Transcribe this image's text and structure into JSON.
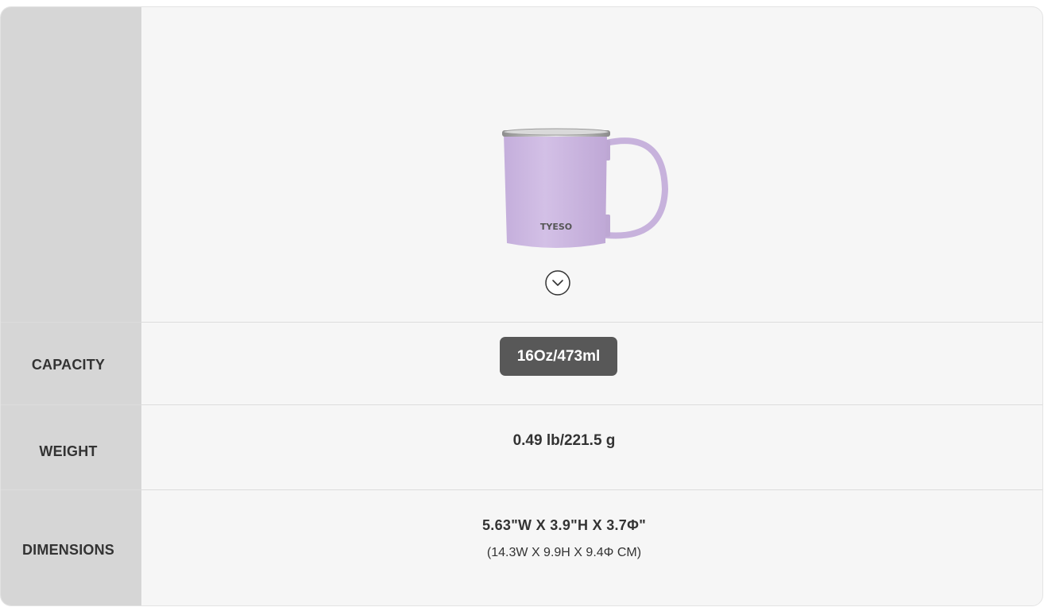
{
  "product": {
    "image_icon": "mug-image",
    "mug_brand": "TYESO",
    "expand_icon": "chevron-down-circle-icon"
  },
  "specs": {
    "capacity": {
      "label": "CAPACITY",
      "value": "16Oz/473ml"
    },
    "weight": {
      "label": "WEIGHT",
      "value": "0.49 lb/221.5 g"
    },
    "dimensions": {
      "label": "DIMENSIONS",
      "value_imperial": "5.63\"W X 3.9\"H X 3.7Φ\"",
      "value_metric": "(14.3W X 9.9H X 9.4Φ CM)"
    }
  },
  "colors": {
    "label_column": "#d6d6d6",
    "content_bg": "#f6f6f6",
    "capacity_button": "#585858",
    "mug_body": "#cdb9e2"
  }
}
